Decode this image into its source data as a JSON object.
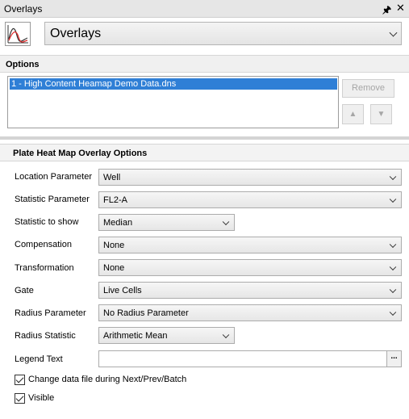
{
  "window": {
    "title": "Overlays",
    "pin_icon": "pin-icon",
    "close_icon": "close-icon"
  },
  "header": {
    "icon": "overlay-chart-icon",
    "selected": "Overlays"
  },
  "options": {
    "heading": "Options",
    "list_items": [
      "1 - High Content Heamap Demo Data.dns"
    ],
    "remove_label": "Remove",
    "up_icon": "up-arrow-icon",
    "down_icon": "down-arrow-icon"
  },
  "heatmap": {
    "heading": "Plate Heat Map Overlay Options",
    "location_parameter": {
      "label": "Location Parameter",
      "value": "Well"
    },
    "statistic_parameter": {
      "label": "Statistic Parameter",
      "value": "FL2-A"
    },
    "statistic_to_show": {
      "label": "Statistic to show",
      "value": "Median"
    },
    "compensation": {
      "label": "Compensation",
      "value": "None"
    },
    "transformation": {
      "label": "Transformation",
      "value": "None"
    },
    "gate": {
      "label": "Gate",
      "value": "Live Cells"
    },
    "radius_parameter": {
      "label": "Radius Parameter",
      "value": "No Radius Parameter"
    },
    "radius_statistic": {
      "label": "Radius Statistic",
      "value": "Arithmetic Mean"
    },
    "legend_text": {
      "label": "Legend Text",
      "value": "",
      "button": "..."
    },
    "change_data_file": {
      "label": "Change data file during Next/Prev/Batch",
      "checked": true
    },
    "visible": {
      "label": "Visible",
      "checked": true
    }
  },
  "colors": {
    "selection": "#2f7fd6",
    "title_bg": "#e6e6e6",
    "section_bg": "#f0f0f0"
  }
}
